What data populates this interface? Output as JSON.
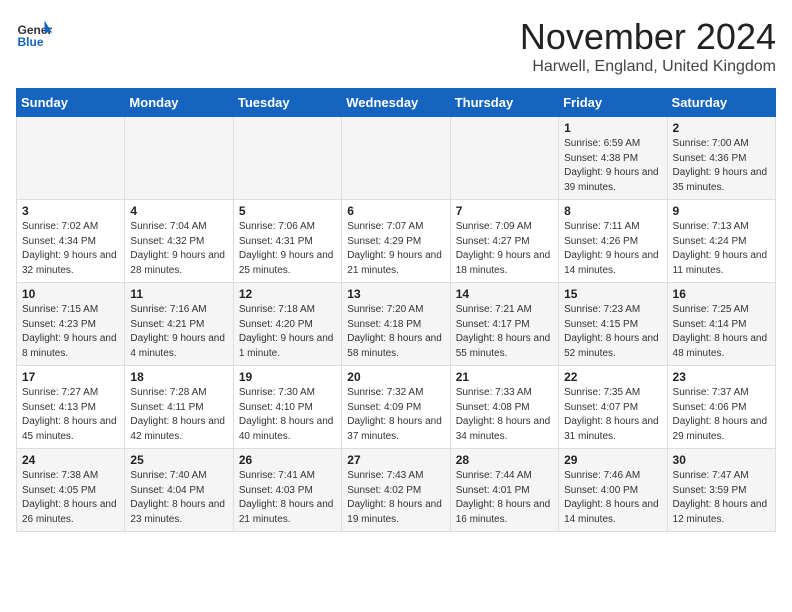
{
  "header": {
    "logo_general": "General",
    "logo_blue": "Blue",
    "month_title": "November 2024",
    "location": "Harwell, England, United Kingdom"
  },
  "weekdays": [
    "Sunday",
    "Monday",
    "Tuesday",
    "Wednesday",
    "Thursday",
    "Friday",
    "Saturday"
  ],
  "weeks": [
    [
      {
        "day": "",
        "info": ""
      },
      {
        "day": "",
        "info": ""
      },
      {
        "day": "",
        "info": ""
      },
      {
        "day": "",
        "info": ""
      },
      {
        "day": "",
        "info": ""
      },
      {
        "day": "1",
        "info": "Sunrise: 6:59 AM\nSunset: 4:38 PM\nDaylight: 9 hours and 39 minutes."
      },
      {
        "day": "2",
        "info": "Sunrise: 7:00 AM\nSunset: 4:36 PM\nDaylight: 9 hours and 35 minutes."
      }
    ],
    [
      {
        "day": "3",
        "info": "Sunrise: 7:02 AM\nSunset: 4:34 PM\nDaylight: 9 hours and 32 minutes."
      },
      {
        "day": "4",
        "info": "Sunrise: 7:04 AM\nSunset: 4:32 PM\nDaylight: 9 hours and 28 minutes."
      },
      {
        "day": "5",
        "info": "Sunrise: 7:06 AM\nSunset: 4:31 PM\nDaylight: 9 hours and 25 minutes."
      },
      {
        "day": "6",
        "info": "Sunrise: 7:07 AM\nSunset: 4:29 PM\nDaylight: 9 hours and 21 minutes."
      },
      {
        "day": "7",
        "info": "Sunrise: 7:09 AM\nSunset: 4:27 PM\nDaylight: 9 hours and 18 minutes."
      },
      {
        "day": "8",
        "info": "Sunrise: 7:11 AM\nSunset: 4:26 PM\nDaylight: 9 hours and 14 minutes."
      },
      {
        "day": "9",
        "info": "Sunrise: 7:13 AM\nSunset: 4:24 PM\nDaylight: 9 hours and 11 minutes."
      }
    ],
    [
      {
        "day": "10",
        "info": "Sunrise: 7:15 AM\nSunset: 4:23 PM\nDaylight: 9 hours and 8 minutes."
      },
      {
        "day": "11",
        "info": "Sunrise: 7:16 AM\nSunset: 4:21 PM\nDaylight: 9 hours and 4 minutes."
      },
      {
        "day": "12",
        "info": "Sunrise: 7:18 AM\nSunset: 4:20 PM\nDaylight: 9 hours and 1 minute."
      },
      {
        "day": "13",
        "info": "Sunrise: 7:20 AM\nSunset: 4:18 PM\nDaylight: 8 hours and 58 minutes."
      },
      {
        "day": "14",
        "info": "Sunrise: 7:21 AM\nSunset: 4:17 PM\nDaylight: 8 hours and 55 minutes."
      },
      {
        "day": "15",
        "info": "Sunrise: 7:23 AM\nSunset: 4:15 PM\nDaylight: 8 hours and 52 minutes."
      },
      {
        "day": "16",
        "info": "Sunrise: 7:25 AM\nSunset: 4:14 PM\nDaylight: 8 hours and 48 minutes."
      }
    ],
    [
      {
        "day": "17",
        "info": "Sunrise: 7:27 AM\nSunset: 4:13 PM\nDaylight: 8 hours and 45 minutes."
      },
      {
        "day": "18",
        "info": "Sunrise: 7:28 AM\nSunset: 4:11 PM\nDaylight: 8 hours and 42 minutes."
      },
      {
        "day": "19",
        "info": "Sunrise: 7:30 AM\nSunset: 4:10 PM\nDaylight: 8 hours and 40 minutes."
      },
      {
        "day": "20",
        "info": "Sunrise: 7:32 AM\nSunset: 4:09 PM\nDaylight: 8 hours and 37 minutes."
      },
      {
        "day": "21",
        "info": "Sunrise: 7:33 AM\nSunset: 4:08 PM\nDaylight: 8 hours and 34 minutes."
      },
      {
        "day": "22",
        "info": "Sunrise: 7:35 AM\nSunset: 4:07 PM\nDaylight: 8 hours and 31 minutes."
      },
      {
        "day": "23",
        "info": "Sunrise: 7:37 AM\nSunset: 4:06 PM\nDaylight: 8 hours and 29 minutes."
      }
    ],
    [
      {
        "day": "24",
        "info": "Sunrise: 7:38 AM\nSunset: 4:05 PM\nDaylight: 8 hours and 26 minutes."
      },
      {
        "day": "25",
        "info": "Sunrise: 7:40 AM\nSunset: 4:04 PM\nDaylight: 8 hours and 23 minutes."
      },
      {
        "day": "26",
        "info": "Sunrise: 7:41 AM\nSunset: 4:03 PM\nDaylight: 8 hours and 21 minutes."
      },
      {
        "day": "27",
        "info": "Sunrise: 7:43 AM\nSunset: 4:02 PM\nDaylight: 8 hours and 19 minutes."
      },
      {
        "day": "28",
        "info": "Sunrise: 7:44 AM\nSunset: 4:01 PM\nDaylight: 8 hours and 16 minutes."
      },
      {
        "day": "29",
        "info": "Sunrise: 7:46 AM\nSunset: 4:00 PM\nDaylight: 8 hours and 14 minutes."
      },
      {
        "day": "30",
        "info": "Sunrise: 7:47 AM\nSunset: 3:59 PM\nDaylight: 8 hours and 12 minutes."
      }
    ]
  ]
}
